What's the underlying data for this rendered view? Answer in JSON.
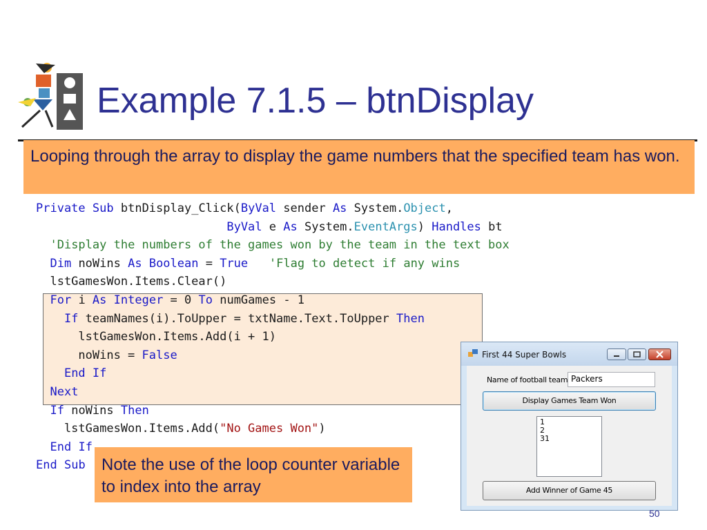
{
  "slide": {
    "title": "Example 7.1.5 – btnDisplay",
    "intro": "Looping through the array to display the game numbers that the specified team has won.",
    "note": "Note the use of the loop counter variable to index into the array",
    "page_number": "50"
  },
  "code": {
    "lines": [
      {
        "parts": [
          {
            "t": "Private",
            "c": "kw"
          },
          {
            "t": " "
          },
          {
            "t": "Sub",
            "c": "kw"
          },
          {
            "t": " btnDisplay_Click("
          },
          {
            "t": "ByVal",
            "c": "kw"
          },
          {
            "t": " sender "
          },
          {
            "t": "As",
            "c": "kw"
          },
          {
            "t": " System."
          },
          {
            "t": "Object",
            "c": "ty"
          },
          {
            "t": ","
          }
        ]
      },
      {
        "parts": [
          {
            "t": "                           "
          },
          {
            "t": "ByVal",
            "c": "kw"
          },
          {
            "t": " e "
          },
          {
            "t": "As",
            "c": "kw"
          },
          {
            "t": " System."
          },
          {
            "t": "EventArgs",
            "c": "ty"
          },
          {
            "t": ") "
          },
          {
            "t": "Handles",
            "c": "kw"
          },
          {
            "t": " bt"
          }
        ]
      },
      {
        "parts": [
          {
            "t": "  "
          },
          {
            "t": "'Display the numbers of the games won by the team in the text box",
            "c": "cm"
          }
        ]
      },
      {
        "parts": [
          {
            "t": "  "
          },
          {
            "t": "Dim",
            "c": "kw"
          },
          {
            "t": " noWins "
          },
          {
            "t": "As",
            "c": "kw"
          },
          {
            "t": " "
          },
          {
            "t": "Boolean",
            "c": "kw"
          },
          {
            "t": " = "
          },
          {
            "t": "True",
            "c": "kw"
          },
          {
            "t": "   "
          },
          {
            "t": "'Flag to detect if any wins",
            "c": "cm"
          }
        ]
      },
      {
        "parts": [
          {
            "t": "  lstGamesWon.Items.Clear()"
          }
        ]
      },
      {
        "parts": [
          {
            "t": "  "
          },
          {
            "t": "For",
            "c": "kw"
          },
          {
            "t": " i "
          },
          {
            "t": "As",
            "c": "kw"
          },
          {
            "t": " "
          },
          {
            "t": "Integer",
            "c": "kw"
          },
          {
            "t": " = 0 "
          },
          {
            "t": "To",
            "c": "kw"
          },
          {
            "t": " numGames - 1"
          }
        ]
      },
      {
        "parts": [
          {
            "t": "    "
          },
          {
            "t": "If",
            "c": "kw"
          },
          {
            "t": " teamNames(i).ToUpper = txtName.Text.ToUpper "
          },
          {
            "t": "Then",
            "c": "kw"
          }
        ]
      },
      {
        "parts": [
          {
            "t": "      lstGamesWon.Items.Add(i + 1)"
          }
        ]
      },
      {
        "parts": [
          {
            "t": "      noWins = "
          },
          {
            "t": "False",
            "c": "kw"
          }
        ]
      },
      {
        "parts": [
          {
            "t": "    "
          },
          {
            "t": "End",
            "c": "kw"
          },
          {
            "t": " "
          },
          {
            "t": "If",
            "c": "kw"
          }
        ]
      },
      {
        "parts": [
          {
            "t": "  "
          },
          {
            "t": "Next",
            "c": "kw"
          }
        ]
      },
      {
        "parts": [
          {
            "t": "  "
          },
          {
            "t": "If",
            "c": "kw"
          },
          {
            "t": " noWins "
          },
          {
            "t": "Then",
            "c": "kw"
          }
        ]
      },
      {
        "parts": [
          {
            "t": "    lstGamesWon.Items.Add("
          },
          {
            "t": "\"No Games Won\"",
            "c": "st"
          },
          {
            "t": ")"
          }
        ]
      },
      {
        "parts": [
          {
            "t": "  "
          },
          {
            "t": "End",
            "c": "kw"
          },
          {
            "t": " "
          },
          {
            "t": "If",
            "c": "kw"
          }
        ]
      },
      {
        "parts": [
          {
            "t": "End",
            "c": "kw"
          },
          {
            "t": " "
          },
          {
            "t": "Sub",
            "c": "kw"
          }
        ]
      }
    ]
  },
  "app": {
    "window_title": "First 44 Super Bowls",
    "team_label": "Name of football team:",
    "team_value": "Packers",
    "display_button": "Display Games Team Won",
    "list_items": [
      "1",
      "2",
      "31"
    ],
    "add_winner_button": "Add Winner of Game 45"
  },
  "colors": {
    "title": "#2e3192",
    "callout": "#ffad60",
    "keyword": "#1919c8",
    "comment": "#2e7d32",
    "type": "#2b91af",
    "string": "#a31515"
  }
}
